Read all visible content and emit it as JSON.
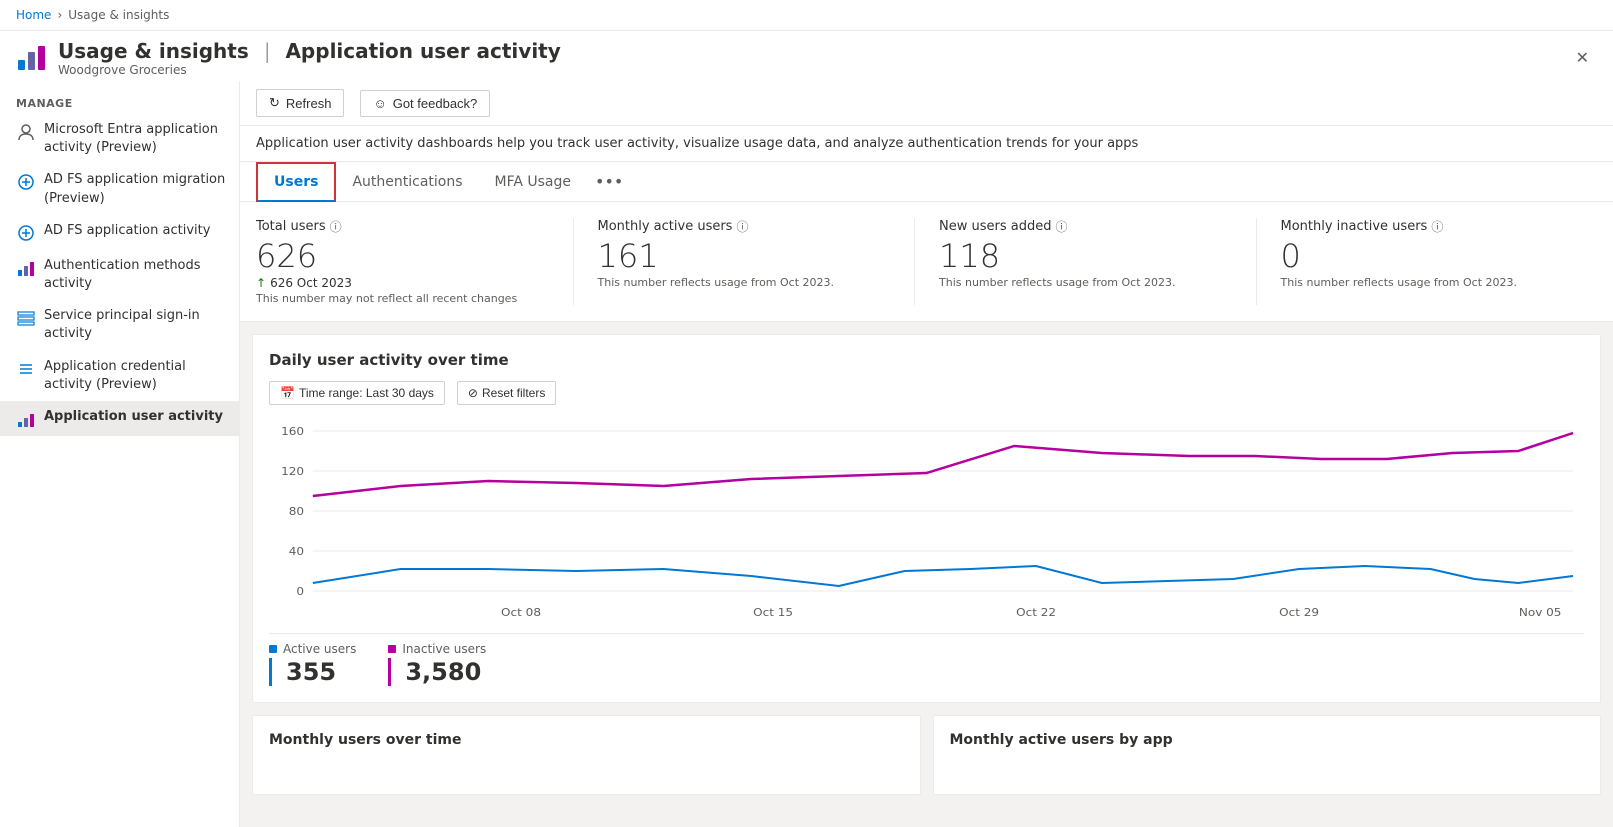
{
  "breadcrumb": {
    "home": "Home",
    "current": "Usage & insights"
  },
  "pageHeader": {
    "title": "Usage & insights",
    "separator": "|",
    "subtitle_page": "Application user activity",
    "org": "Woodgrove Groceries"
  },
  "toolbar": {
    "refresh_label": "Refresh",
    "feedback_label": "Got feedback?"
  },
  "description": "Application user activity dashboards help you track user activity, visualize usage data, and analyze authentication trends for your apps",
  "tabs": [
    {
      "id": "users",
      "label": "Users",
      "active": true
    },
    {
      "id": "authentications",
      "label": "Authentications",
      "active": false
    },
    {
      "id": "mfa",
      "label": "MFA Usage",
      "active": false
    }
  ],
  "stats": [
    {
      "id": "total-users",
      "label": "Total users",
      "value": "626",
      "change": "↑ 626 Oct 2023",
      "note": "This number may not reflect all recent changes"
    },
    {
      "id": "monthly-active",
      "label": "Monthly active users",
      "value": "161",
      "change": "",
      "note": "This number reflects usage from Oct 2023."
    },
    {
      "id": "new-users",
      "label": "New users added",
      "value": "118",
      "change": "",
      "note": "This number reflects usage from Oct 2023."
    },
    {
      "id": "monthly-inactive",
      "label": "Monthly inactive users",
      "value": "0",
      "change": "",
      "note": "This number reflects usage from Oct 2023."
    }
  ],
  "chart": {
    "title": "Daily user activity over time",
    "time_range_label": "Time range: Last 30 days",
    "reset_filters_label": "Reset filters",
    "x_labels": [
      "Oct 08",
      "Oct 15",
      "Oct 22",
      "Oct 29",
      "Nov 05"
    ],
    "y_labels": [
      "0",
      "40",
      "80",
      "120",
      "160"
    ],
    "active_users_color": "#0078d4",
    "inactive_users_color": "#b4009e",
    "legend": [
      {
        "id": "active",
        "label": "Active users",
        "value": "355",
        "color": "#0078d4"
      },
      {
        "id": "inactive",
        "label": "Inactive users",
        "value": "3,580",
        "color": "#b4009e"
      }
    ]
  },
  "sidebar": {
    "manage_label": "Manage",
    "items": [
      {
        "id": "entra-app",
        "label": "Microsoft Entra application activity (Preview)",
        "icon": "person-icon",
        "active": false
      },
      {
        "id": "adfs-migration",
        "label": "AD FS application migration (Preview)",
        "icon": "adfs-icon",
        "active": false
      },
      {
        "id": "adfs-activity",
        "label": "AD FS application activity",
        "icon": "adfs2-icon",
        "active": false
      },
      {
        "id": "auth-methods",
        "label": "Authentication methods activity",
        "icon": "chart-icon",
        "active": false
      },
      {
        "id": "service-principal",
        "label": "Service principal sign-in activity",
        "icon": "table-icon",
        "active": false
      },
      {
        "id": "app-credential",
        "label": "Application credential activity (Preview)",
        "icon": "list-icon",
        "active": false
      },
      {
        "id": "app-user-activity",
        "label": "Application user activity",
        "icon": "bar-icon",
        "active": true
      }
    ]
  },
  "bottomCharts": [
    {
      "id": "monthly-users-time",
      "title": "Monthly users over time"
    },
    {
      "id": "monthly-active-by-app",
      "title": "Monthly active users by app"
    }
  ]
}
